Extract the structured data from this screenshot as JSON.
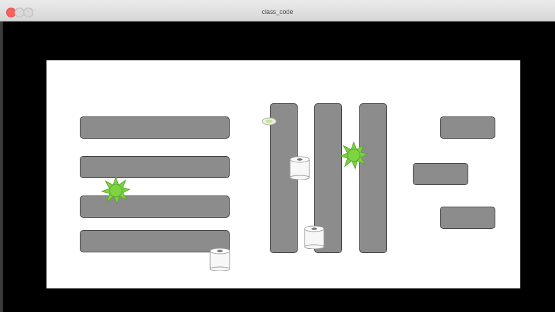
{
  "window": {
    "title": "class_code"
  },
  "game": {
    "arena_color": "#ffffff",
    "wall_color": "#8c8c8c",
    "wall_border_color": "#3c3c3c",
    "germ_color": "#7ed340",
    "walls": [
      {
        "id": "left-bar-1",
        "orientation": "horizontal"
      },
      {
        "id": "left-bar-2",
        "orientation": "horizontal"
      },
      {
        "id": "left-bar-3",
        "orientation": "horizontal"
      },
      {
        "id": "left-bar-4",
        "orientation": "horizontal"
      },
      {
        "id": "pillar-1",
        "orientation": "vertical"
      },
      {
        "id": "pillar-2",
        "orientation": "vertical"
      },
      {
        "id": "pillar-3",
        "orientation": "vertical"
      },
      {
        "id": "right-block-1",
        "orientation": "horizontal"
      },
      {
        "id": "right-block-2",
        "orientation": "horizontal"
      },
      {
        "id": "right-block-3",
        "orientation": "horizontal"
      }
    ],
    "sprites": [
      {
        "type": "germ-splat",
        "count": 2
      },
      {
        "type": "toilet-paper-roll",
        "count": 3
      },
      {
        "type": "soap-player",
        "count": 1
      }
    ]
  }
}
